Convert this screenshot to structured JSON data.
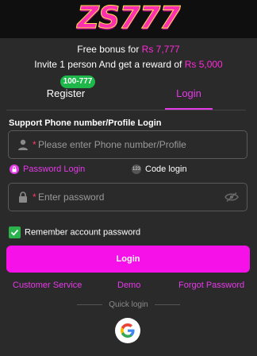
{
  "brand": {
    "logo_text_1": "ZS",
    "logo_text_2": "777"
  },
  "promo": {
    "line1_text": "Free bonus for ",
    "line1_amount": "Rs 7,777",
    "line2_text": "Invite 1 person And get a reward of ",
    "line2_amount": "Rs 5,000"
  },
  "tabs": {
    "register_label": "Register",
    "register_badge": "100-777",
    "login_label": "Login",
    "active": "login"
  },
  "form": {
    "phone_label": "Support Phone number/Profile Login",
    "phone_required_mark": "*",
    "phone_placeholder": "Please enter Phone number/Profile",
    "phone_value": "",
    "mode_password_label": "Password Login",
    "mode_code_label": "Code login",
    "mode_code_icon_text": "123",
    "password_required_mark": "*",
    "password_placeholder": "Enter password",
    "password_value": "",
    "remember_label": "Remember account password",
    "remember_checked": true,
    "login_button": "Login"
  },
  "links": {
    "customer_service": "Customer Service",
    "demo": "Demo",
    "forgot_password": "Forgot Password"
  },
  "quick_login": {
    "label": "Quick login",
    "providers": [
      "google-icon"
    ]
  },
  "colors": {
    "accent": "#f611e9",
    "accent_text": "#e53ae8",
    "badge": "#1db74a",
    "background": "#2a2a2a",
    "topbar": "#0f0f0f"
  }
}
